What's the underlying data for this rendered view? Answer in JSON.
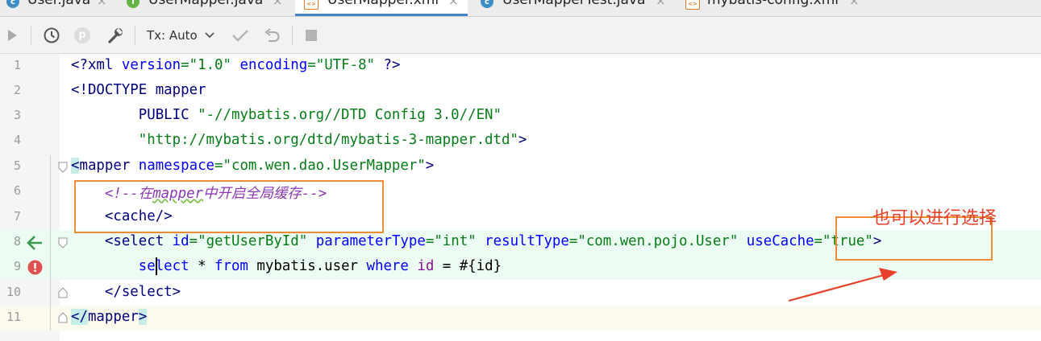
{
  "tabs": [
    {
      "label": "User.java",
      "icon": "class-c-icon",
      "badge": "c",
      "active": false
    },
    {
      "label": "UserMapper.java",
      "icon": "interface-i-icon",
      "badge": "I",
      "active": false
    },
    {
      "label": "UserMapper.xml",
      "icon": "xml-file-icon",
      "badge": "<>",
      "active": true
    },
    {
      "label": "UserMapperTest.java",
      "icon": "class-c-icon",
      "badge": "c",
      "active": false
    },
    {
      "label": "mybatis-config.xml",
      "icon": "xml-file-icon",
      "badge": "<>",
      "active": false
    }
  ],
  "tab_close_glyph": "×",
  "toolbar": {
    "tx_label": "Tx: Auto",
    "buttons": [
      "run-icon",
      "history-icon",
      "p-icon",
      "wrench-icon",
      "tx-dropdown",
      "commit-check-icon",
      "rollback-icon",
      "stop-icon"
    ],
    "p_glyph": "p"
  },
  "editor": {
    "line_numbers": [
      "1",
      "2",
      "3",
      "4",
      "5",
      "6",
      "7",
      "8",
      "9",
      "10",
      "11"
    ],
    "lines": {
      "l1": {
        "a": "<?",
        "b": "xml ",
        "c": "version",
        "d": "=",
        "e": "\"1.0\"",
        "f": " ",
        "g": "encoding",
        "h": "=",
        "i": "\"UTF-8\"",
        "j": " ?>"
      },
      "l2": {
        "a": "<!DOCTYPE ",
        "b": "mapper"
      },
      "l3": {
        "a": "        PUBLIC ",
        "b": "\"-//mybatis.org//DTD Config 3.0//EN\""
      },
      "l4": {
        "a": "        ",
        "b": "\"http://mybatis.org/dtd/mybatis-3-mapper.dtd\"",
        "c": ">"
      },
      "l5": {
        "a": "<",
        "b": "mapper",
        "c": " ",
        "d": "namespace",
        "e": "=",
        "f": "\"com.wen.dao.UserMapper\"",
        "g": ">"
      },
      "l6": {
        "a": "    ",
        "b": "<!--",
        "c": "在",
        "d": "mapper",
        "e": "中开启全局缓存",
        "f": "-->"
      },
      "l7": {
        "a": "    <",
        "b": "cache",
        "c": "/>"
      },
      "l8": {
        "a": "    <",
        "b": "select",
        "c": " ",
        "d": "id",
        "e": "=",
        "f": "\"getUserById\"",
        "g": " ",
        "h": "parameterType",
        "i": "=",
        "j": "\"int\"",
        "k": " ",
        "l": "resultType",
        "m": "=",
        "n": "\"com.wen.pojo.User\"",
        "o": " ",
        "p": "useCache",
        "q": "=",
        "r": "\"true\"",
        "s": ">"
      },
      "l9": {
        "a": "        ",
        "b": "select",
        "c": " * ",
        "d": "from",
        "e": " mybatis.user ",
        "f": "where",
        "g": " ",
        "h": "id",
        "i": " = #{id}"
      },
      "l10": {
        "a": "    </",
        "b": "select",
        "c": ">"
      },
      "l11": {
        "a": "</",
        "b": "mapper",
        "c": ">"
      }
    }
  },
  "annotation": {
    "note": "也可以进行选择",
    "box_color": "#ef8a35",
    "arrow_color": "#e8412c"
  },
  "colors": {
    "tag": "#000080",
    "attribute": "#0000ff",
    "string": "#067d17",
    "comment": "#8c38b5",
    "active_tab_underline": "#4083c9"
  }
}
